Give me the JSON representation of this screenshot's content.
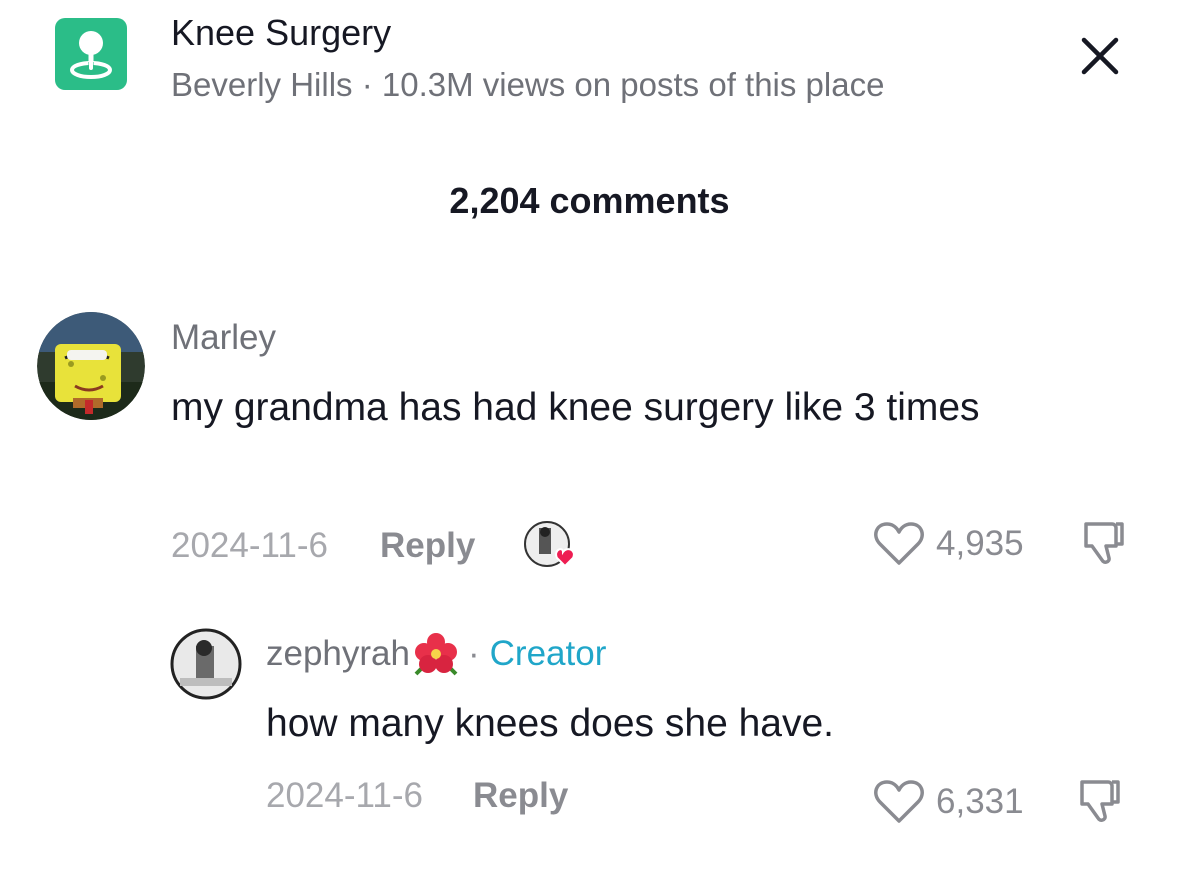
{
  "place": {
    "icon": "location-pin-icon",
    "title": "Knee Surgery",
    "subtitle": "Beverly Hills · 10.3M views on posts of this place",
    "accent": "#2bbd88"
  },
  "close": {
    "icon": "close-icon"
  },
  "comments_count": "2,204 comments",
  "comments": [
    {
      "author": "Marley",
      "text": "my grandma has had knee surgery like 3 times",
      "date": "2024-11-6",
      "reply_label": "Reply",
      "likes": "4,935",
      "liked_by_creator": true
    }
  ],
  "reply": {
    "author": "zephyrah",
    "author_emoji": "hibiscus-flower-icon",
    "creator_separator": "·",
    "creator_label": "Creator",
    "creator_color": "#20a6c9",
    "text": "how many knees does she have.",
    "date": "2024-11-6",
    "reply_label": "Reply",
    "likes": "6,331"
  }
}
